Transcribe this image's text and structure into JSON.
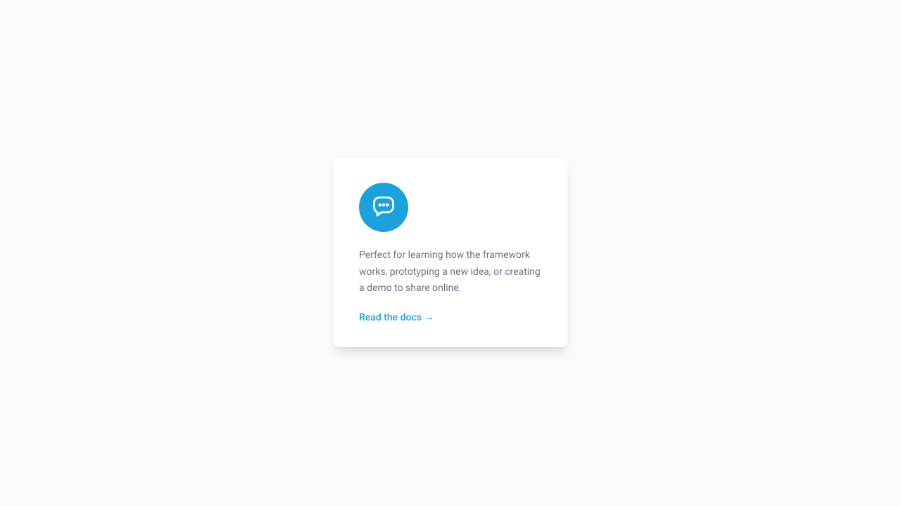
{
  "card": {
    "icon": "chat-bubble-icon",
    "description": "Perfect for learning how the framework works, prototyping a new idea, or creating a demo to share online.",
    "link_text": "Read the docs →"
  },
  "colors": {
    "accent": "#1da1dd",
    "background": "#f9fafb",
    "card_bg": "#ffffff",
    "text_muted": "#6b7280"
  }
}
